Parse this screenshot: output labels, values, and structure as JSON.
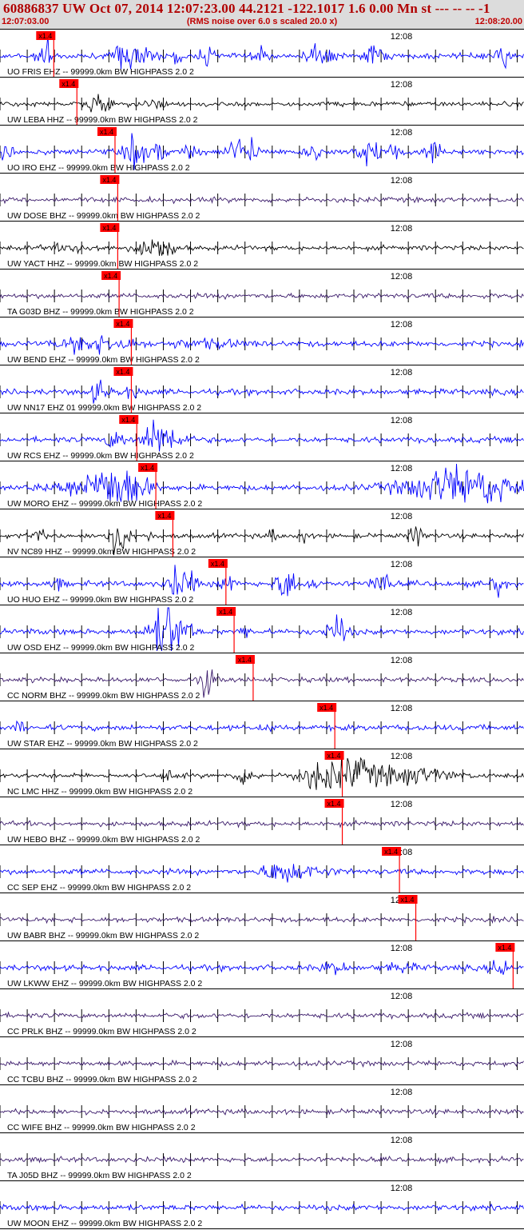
{
  "header": {
    "title": "60886837 UW Oct 07, 2014 12:07:23.00   44.2121 -122.1017  1.6 0.00 Mn st --- -- --  -1",
    "start_time": "12:07:03.00",
    "noise_note": "(RMS noise over 6.0 s scaled 20.0 x)",
    "end_time": "12:08:20.00"
  },
  "colors": {
    "blue": "#0000ff",
    "black": "#000000",
    "purple": "#3a1a6a",
    "pick": "#ff0000",
    "header_bg": "#dcdcdc",
    "header_text": "#c00000"
  },
  "chart_data": {
    "type": "line",
    "time_axis": {
      "start": "12:07:03.00",
      "end": "12:08:20.00",
      "tick_label": "12:08"
    },
    "pick_label": "x1.4",
    "traces": [
      {
        "label": "UO FRIS EHZ -- 99999.0km BW  HIGHPASS  2.0  2",
        "color": "blue",
        "pick_time": "12:07:10.9"
      },
      {
        "label": "UW LEBA HHZ -- 99999.0km BW  HIGHPASS  2.0  2",
        "color": "black",
        "pick_time": "12:07:14.3"
      },
      {
        "label": "UO IRO EHZ -- 99999.0km BW  HIGHPASS  2.0  2",
        "color": "blue",
        "pick_time": "12:07:19.9"
      },
      {
        "label": "UW DOSE BHZ -- 99999.0km BW  HIGHPASS  2.0  2",
        "color": "purple",
        "pick_time": "12:07:20.3"
      },
      {
        "label": "UW YACT HHZ -- 99999.0km BW  HIGHPASS  2.0  2",
        "color": "black",
        "pick_time": "12:07:20.3"
      },
      {
        "label": "TA G03D BHZ -- 99999.0km BW  HIGHPASS  2.0  2",
        "color": "purple",
        "pick_time": "12:07:20.5"
      },
      {
        "label": "UW BEND EHZ -- 99999.0km BW  HIGHPASS  2.0  2",
        "color": "blue",
        "pick_time": "12:07:22.3"
      },
      {
        "label": "UW NN17 EHZ 01 99999.0km BW  HIGHPASS  2.0  2",
        "color": "blue",
        "pick_time": "12:07:22.3"
      },
      {
        "label": "UW RCS EHZ -- 99999.0km BW  HIGHPASS  2.0  2",
        "color": "blue",
        "pick_time": "12:07:23.1"
      },
      {
        "label": "UW MORO EHZ -- 99999.0km BW  HIGHPASS  2.0  2",
        "color": "blue",
        "pick_time": "12:07:25.9"
      },
      {
        "label": "NV NC89 HHZ -- 99999.0km BW  HIGHPASS  2.0  2",
        "color": "black",
        "pick_time": "12:07:28.4"
      },
      {
        "label": "UO HUO EHZ -- 99999.0km BW  HIGHPASS  2.0  2",
        "color": "blue",
        "pick_time": "12:07:36.2"
      },
      {
        "label": "UW OSD EHZ -- 99999.0km BW  HIGHPASS  2.0  2",
        "color": "blue",
        "pick_time": "12:07:37.4"
      },
      {
        "label": "CC NORM BHZ -- 99999.0km BW  HIGHPASS  2.0  2",
        "color": "purple",
        "pick_time": "12:07:40.2"
      },
      {
        "label": "UW STAR EHZ -- 99999.0km BW  HIGHPASS  2.0  2",
        "color": "blue",
        "pick_time": "12:07:52.2"
      },
      {
        "label": "NC LMC HHZ -- 99999.0km BW  HIGHPASS  2.0  2",
        "color": "black",
        "pick_time": "12:07:53.3"
      },
      {
        "label": "UW HEBO BHZ -- 99999.0km BW  HIGHPASS  2.0  2",
        "color": "purple",
        "pick_time": "12:07:53.3"
      },
      {
        "label": "CC SEP EHZ -- 99999.0km BW  HIGHPASS  2.0  2",
        "color": "blue",
        "pick_time": "12:08:01.7"
      },
      {
        "label": "UW BABR BHZ -- 99999.0km BW  HIGHPASS  2.0  2",
        "color": "purple",
        "pick_time": "12:08:04.1"
      },
      {
        "label": "UW LKWW EHZ -- 99999.0km BW  HIGHPASS  2.0  2",
        "color": "blue",
        "pick_time": "12:08:18.4"
      },
      {
        "label": "CC PRLK BHZ -- 99999.0km BW  HIGHPASS  2.0  2",
        "color": "purple",
        "pick_time": null
      },
      {
        "label": "CC TCBU BHZ -- 99999.0km BW  HIGHPASS  2.0  2",
        "color": "purple",
        "pick_time": null
      },
      {
        "label": "CC WIFE BHZ -- 99999.0km BW  HIGHPASS  2.0  2",
        "color": "purple",
        "pick_time": null
      },
      {
        "label": "TA J05D BHZ -- 99999.0km BW  HIGHPASS  2.0  2",
        "color": "purple",
        "pick_time": null
      },
      {
        "label": "UW MOON EHZ -- 99999.0km BW  HIGHPASS  2.0  2",
        "color": "blue",
        "pick_time": null
      }
    ]
  }
}
